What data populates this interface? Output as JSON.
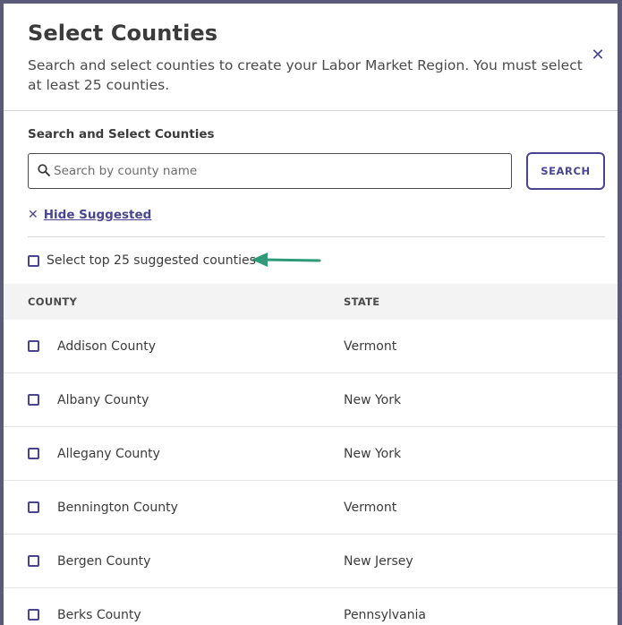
{
  "modal": {
    "title": "Select Counties",
    "subtitle": "Search and select counties to create your Labor Market Region. You must select at least 25 counties.",
    "close_icon": "close-icon"
  },
  "search": {
    "label": "Search and Select Counties",
    "placeholder": "Search by county name",
    "value": "",
    "button_label": "SEARCH",
    "icon": "search-icon"
  },
  "suggested": {
    "hide_label": "Hide Suggested",
    "select_top_label": "Select top 25 suggested counties",
    "select_top_checked": false
  },
  "table": {
    "headers": {
      "county": "COUNTY",
      "state": "STATE"
    },
    "rows": [
      {
        "county": "Addison County",
        "state": "Vermont",
        "checked": false
      },
      {
        "county": "Albany County",
        "state": "New York",
        "checked": false
      },
      {
        "county": "Allegany County",
        "state": "New York",
        "checked": false
      },
      {
        "county": "Bennington County",
        "state": "Vermont",
        "checked": false
      },
      {
        "county": "Bergen County",
        "state": "New Jersey",
        "checked": false
      },
      {
        "county": "Berks County",
        "state": "Pennsylvania",
        "checked": false
      }
    ]
  },
  "colors": {
    "accent": "#4b4591",
    "arrow": "#2e9a78",
    "frame": "#5b5a78"
  }
}
